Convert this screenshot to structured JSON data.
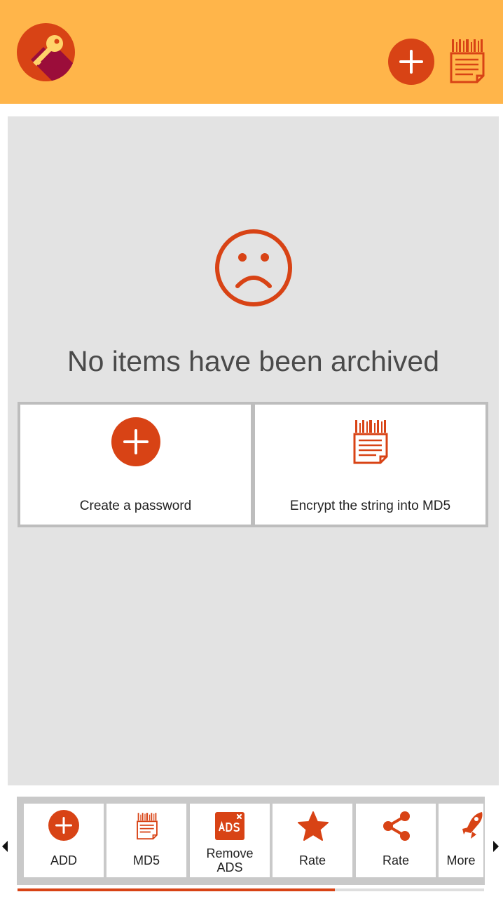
{
  "header": {
    "logo_icon": "key-icon",
    "add_icon": "plus-circle-icon",
    "md5_icon": "md5-document-icon",
    "background": "#ffb54a",
    "accent": "#d84315"
  },
  "empty_state": {
    "icon": "sad-face-icon",
    "message": "No items have been archived"
  },
  "actions": [
    {
      "label": "Create a password",
      "icon": "plus-circle-icon"
    },
    {
      "label": "Encrypt the string into MD5",
      "icon": "md5-document-icon"
    }
  ],
  "bottom_bar": {
    "items": [
      {
        "label": "ADD",
        "icon": "plus-circle-icon"
      },
      {
        "label": "MD5",
        "icon": "md5-document-icon"
      },
      {
        "label_line1": "Remove",
        "label_line2": "ADS",
        "icon": "remove-ads-icon"
      },
      {
        "label": "Rate",
        "icon": "star-icon"
      },
      {
        "label": "Rate",
        "icon": "share-icon"
      },
      {
        "label": "More",
        "icon": "rocket-icon"
      }
    ],
    "scroll_progress": 0.68
  }
}
